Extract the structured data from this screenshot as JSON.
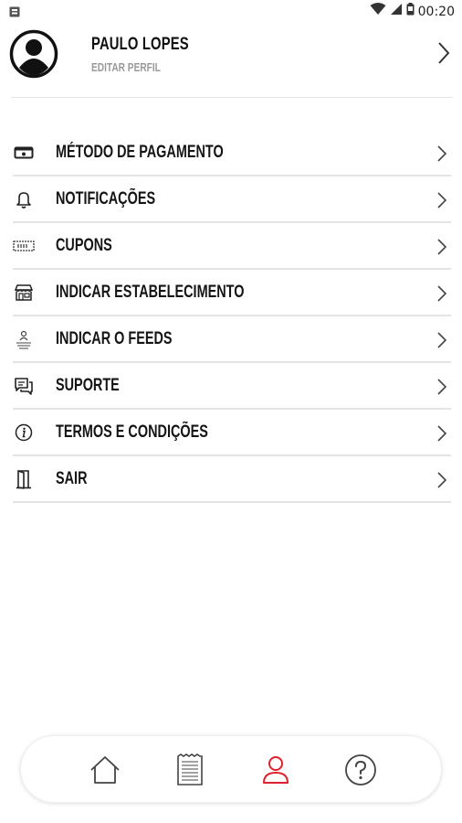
{
  "status_bar": {
    "time": "00:20",
    "left_icon": "notification-icon",
    "icons": [
      "wifi-icon",
      "signal-icon",
      "battery-icon"
    ]
  },
  "profile": {
    "name": "PAULO LOPES",
    "subtitle": "EDITAR PERFIL",
    "avatar_icon": "avatar-icon"
  },
  "menu": {
    "items": [
      {
        "label": "MÉTODO DE PAGAMENTO",
        "icon": "wallet-icon"
      },
      {
        "label": "NOTIFICAÇÕES",
        "icon": "bell-icon"
      },
      {
        "label": "CUPONS",
        "icon": "coupon-icon"
      },
      {
        "label": "INDICAR ESTABELECIMENTO",
        "icon": "store-icon"
      },
      {
        "label": "INDICAR O FEEDS",
        "icon": "recommend-icon"
      },
      {
        "label": "SUPORTE",
        "icon": "chat-icon"
      },
      {
        "label": "TERMOS E CONDIÇÕES",
        "icon": "info-icon"
      },
      {
        "label": "SAIR",
        "icon": "door-icon"
      }
    ]
  },
  "bottom_nav": {
    "items": [
      {
        "name": "home",
        "icon": "home-icon",
        "active": false
      },
      {
        "name": "orders",
        "icon": "receipt-icon",
        "active": false
      },
      {
        "name": "profile",
        "icon": "user-icon",
        "active": true
      },
      {
        "name": "help",
        "icon": "help-icon",
        "active": false
      }
    ],
    "active_color": "#e0202c",
    "inactive_color": "#555555"
  },
  "colors": {
    "text": "#151515",
    "subtext": "#9a9a9a",
    "divider": "#e4e4e4",
    "accent": "#e0202c"
  }
}
